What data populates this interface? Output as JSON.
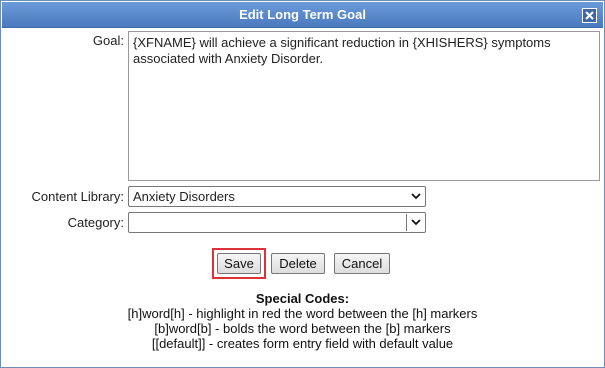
{
  "dialog": {
    "title": "Edit Long Term Goal",
    "close_icon": "close-icon",
    "close_glyph": "✕"
  },
  "form": {
    "goal_label": "Goal:",
    "goal_value": "{XFNAME} will achieve a significant reduction in {XHISHERS} symptoms associated with Anxiety Disorder.",
    "content_library_label": "Content Library:",
    "content_library_value": "Anxiety Disorders",
    "category_label": "Category:",
    "category_value": ""
  },
  "buttons": {
    "save": "Save",
    "delete": "Delete",
    "cancel": "Cancel"
  },
  "special_codes": {
    "heading": "Special Codes:",
    "lines": [
      "[h]word[h] - highlight in red the word between the [h] markers",
      "[b]word[b] - bolds the word between the [b] markers",
      "[[default]] - creates form entry field with default value"
    ]
  },
  "colors": {
    "titlebar": "#4a79bf",
    "highlight": "#e0303a"
  }
}
